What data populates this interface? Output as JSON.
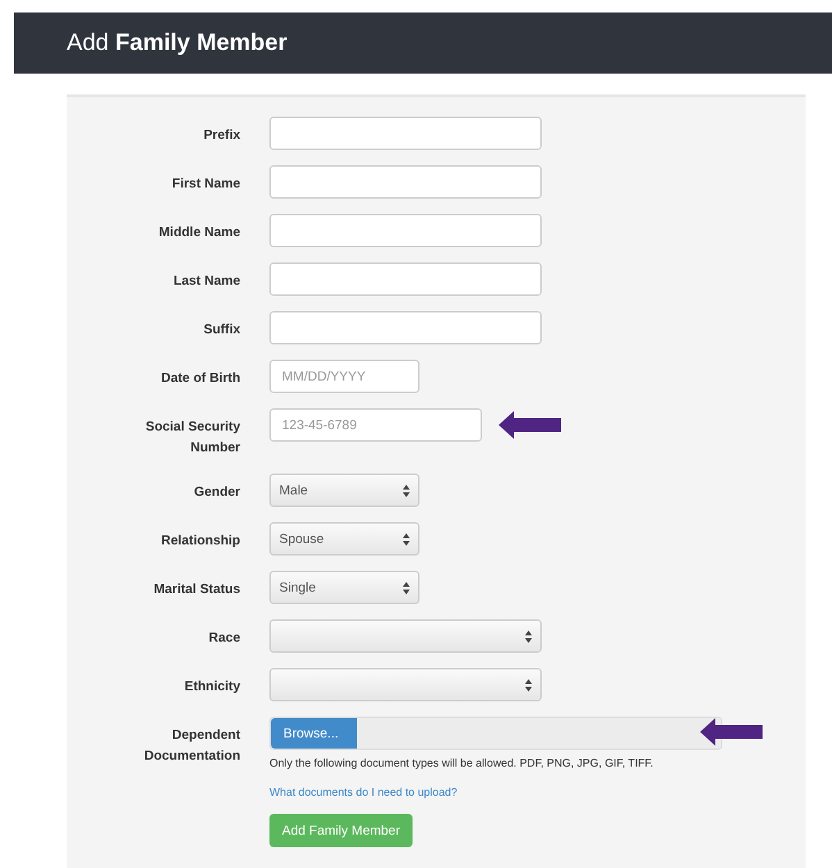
{
  "header": {
    "title": "Add **Family Member**"
  },
  "fields": [
    {
      "label": "Prefix",
      "kind": "text",
      "arrow": false
    },
    {
      "label": "First Name",
      "kind": "text",
      "arrow": false
    },
    {
      "label": "Middle Name",
      "kind": "text",
      "arrow": false
    },
    {
      "label": "Last Name",
      "kind": "text",
      "arrow": false
    },
    {
      "label": "Suffix",
      "kind": "text",
      "arrow": false
    },
    {
      "label": "Date of Birth",
      "kind": "text",
      "placeholder": "MM/DD/YYYY",
      "arrow": false
    },
    {
      "label": "Social Security Number",
      "kind": "text",
      "placeholder": "123-45-6789",
      "arrow": true
    },
    {
      "label": "Gender",
      "kind": "select",
      "value": "Male",
      "arrow": false
    },
    {
      "label": "Relationship",
      "kind": "select",
      "value": "Spouse",
      "arrow": false
    },
    {
      "label": "Marital Status",
      "kind": "select",
      "value": "Single",
      "arrow": false
    },
    {
      "label": "Race",
      "kind": "select",
      "arrow": false
    },
    {
      "label": "Ethnicity",
      "kind": "select",
      "arrow": false
    },
    {
      "label": "Dependent Documentation",
      "kind": "file",
      "button": "Browse...",
      "help": "Only the following document types will be allowed. PDF, PNG, JPG, GIF, TIFF.",
      "link": "What documents do I need to upload?",
      "arrow": true
    }
  ],
  "submit": "Add Family Member"
}
